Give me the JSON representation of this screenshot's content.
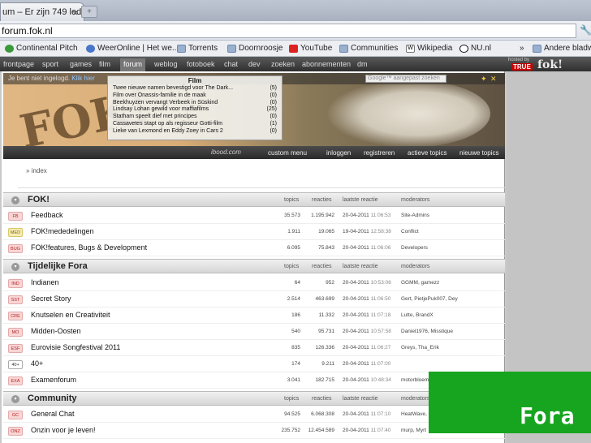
{
  "browser": {
    "tab_title": "um – Er zijn 749 leden",
    "tab_close": "✕",
    "new_tab": "+",
    "url": "forum.fok.nl",
    "wrench_icon": "🔧",
    "bookmarks": [
      {
        "label": "Continental Pitch",
        "icon": "cp"
      },
      {
        "label": "WeerOnline | Het we...",
        "icon": "site"
      },
      {
        "label": "Torrents",
        "icon": "folder"
      },
      {
        "label": "Doornroosje",
        "icon": "folder"
      },
      {
        "label": "YouTube",
        "icon": "yt"
      },
      {
        "label": "Communities",
        "icon": "folder"
      },
      {
        "label": "Wikipedia",
        "icon": "wiki"
      },
      {
        "label": "NU.nl",
        "icon": "nu"
      },
      {
        "label": "»",
        "icon": ""
      },
      {
        "label": "Andere bladwijzers",
        "icon": "folder"
      }
    ]
  },
  "fok_nav": {
    "items": [
      "frontpage",
      "sport",
      "games",
      "film",
      "forum",
      "weblog",
      "fotoboek",
      "chat",
      "dev",
      "zoeken",
      "abonnementen",
      "dm"
    ],
    "active": "forum",
    "hosted_by": "hosted by",
    "true_logo": "TRUE",
    "fok_logo": "fok!"
  },
  "banner": {
    "login_text": "Je bent niet ingelogd.",
    "login_link": "Klik hier",
    "search_placeholder": "Google™ aangepast zoeken",
    "fok_art": "FOK!",
    "ibood": "ibood.com",
    "bottom_items": [
      "custom menu",
      "inloggen",
      "registreren",
      "actieve topics",
      "nieuwe topics"
    ]
  },
  "film_dropdown": {
    "title": "Film",
    "items": [
      {
        "title": "Twee nieuwe namen bevestigd voor The Dark...",
        "count": "(5)"
      },
      {
        "title": "Film over Onassis-familie in de maak",
        "count": "(0)"
      },
      {
        "title": "Beekhuyzen vervangt Verbeek in Süskind",
        "count": "(0)"
      },
      {
        "title": "Lindsay Lohan gewild voor maffiafilms",
        "count": "(25)"
      },
      {
        "title": "Statham speelt dief met principes",
        "count": "(0)"
      },
      {
        "title": "Cassavetes stapt op als regisseur Gotti-film",
        "count": "(1)"
      },
      {
        "title": "Lieke van Lexmond en Eddy Zoey in Cars 2",
        "count": "(0)"
      }
    ]
  },
  "breadcrumb": "» index",
  "columns": {
    "topics": "topics",
    "reacties": "reacties",
    "last": "laatste reactie",
    "mods": "moderators"
  },
  "sections": [
    {
      "title": "FOK!",
      "toggle": "▾",
      "rows": [
        {
          "badge": "FB",
          "badge_style": "red",
          "name": "Feedback",
          "topics": "35.573",
          "reacties": "1.195.942",
          "date": "20-04-2011",
          "time": "11:06:53",
          "mods": "Site-Admins"
        },
        {
          "badge": "MED",
          "badge_style": "yellow",
          "name": "FOK!mededelingen",
          "topics": "1.911",
          "reacties": "19.065",
          "date": "19-04-2011",
          "time": "12:58:38",
          "mods": "Conflict"
        },
        {
          "badge": "BUG",
          "badge_style": "red",
          "name": "FOK!features, Bugs & Development",
          "topics": "6.095",
          "reacties": "75.843",
          "date": "20-04-2011",
          "time": "11:06:06",
          "mods": "Developers"
        }
      ]
    },
    {
      "title": "Tijdelijke Fora",
      "toggle": "▾",
      "rows": [
        {
          "badge": "IND",
          "badge_style": "red",
          "name": "Indianen",
          "topics": "64",
          "reacties": "952",
          "date": "20-04-2011",
          "time": "10:53:06",
          "mods": "GGMM, gamezz"
        },
        {
          "badge": "SST",
          "badge_style": "red",
          "name": "Secret Story",
          "topics": "2.514",
          "reacties": "463.699",
          "date": "20-04-2011",
          "time": "11:06:50",
          "mods": "Gert, PietjePuk007, Dey"
        },
        {
          "badge": "CRE",
          "badge_style": "red",
          "name": "Knutselen en Creativiteit",
          "topics": "186",
          "reacties": "11.332",
          "date": "20-04-2011",
          "time": "11:07:18",
          "mods": "Lutte, BrandX"
        },
        {
          "badge": "MO",
          "badge_style": "red",
          "name": "Midden-Oosten",
          "topics": "540",
          "reacties": "95.731",
          "date": "20-04-2011",
          "time": "10:57:58",
          "mods": "Daniel1976, Misstique"
        },
        {
          "badge": "ESF",
          "badge_style": "red",
          "name": "Eurovisie Songfestival 2011",
          "topics": "835",
          "reacties": "126.336",
          "date": "20-04-2011",
          "time": "11:06:27",
          "mods": "Greys, Tha_Erik"
        },
        {
          "badge": "40+",
          "badge_style": "white",
          "name": "40+",
          "topics": "174",
          "reacties": "9.211",
          "date": "20-04-2011",
          "time": "11:07:00",
          "mods": ""
        },
        {
          "badge": "EXA",
          "badge_style": "red",
          "name": "Examenforum",
          "topics": "3.041",
          "reacties": "182.715",
          "date": "20-04-2011",
          "time": "10:48:34",
          "mods": "motorbloemp"
        }
      ]
    },
    {
      "title": "Community",
      "toggle": "▾",
      "rows": [
        {
          "badge": "GC",
          "badge_style": "red",
          "name": "General Chat",
          "topics": "94.525",
          "reacties": "6.068.308",
          "date": "20-04-2011",
          "time": "11:07:10",
          "mods": "HeatWave,"
        },
        {
          "badge": "ONZ",
          "badge_style": "red",
          "name": "Onzin voor je leven!",
          "topics": "235.752",
          "reacties": "12.454.589",
          "date": "20-04-2011",
          "time": "11:07:40",
          "mods": "murp, Myrt"
        }
      ]
    }
  ],
  "overlay_label": "Fora",
  "colors": {
    "overlay_green": "#17a51f",
    "nav_dark": "#2f2f2f",
    "badge_red": "#f7d6d6"
  }
}
